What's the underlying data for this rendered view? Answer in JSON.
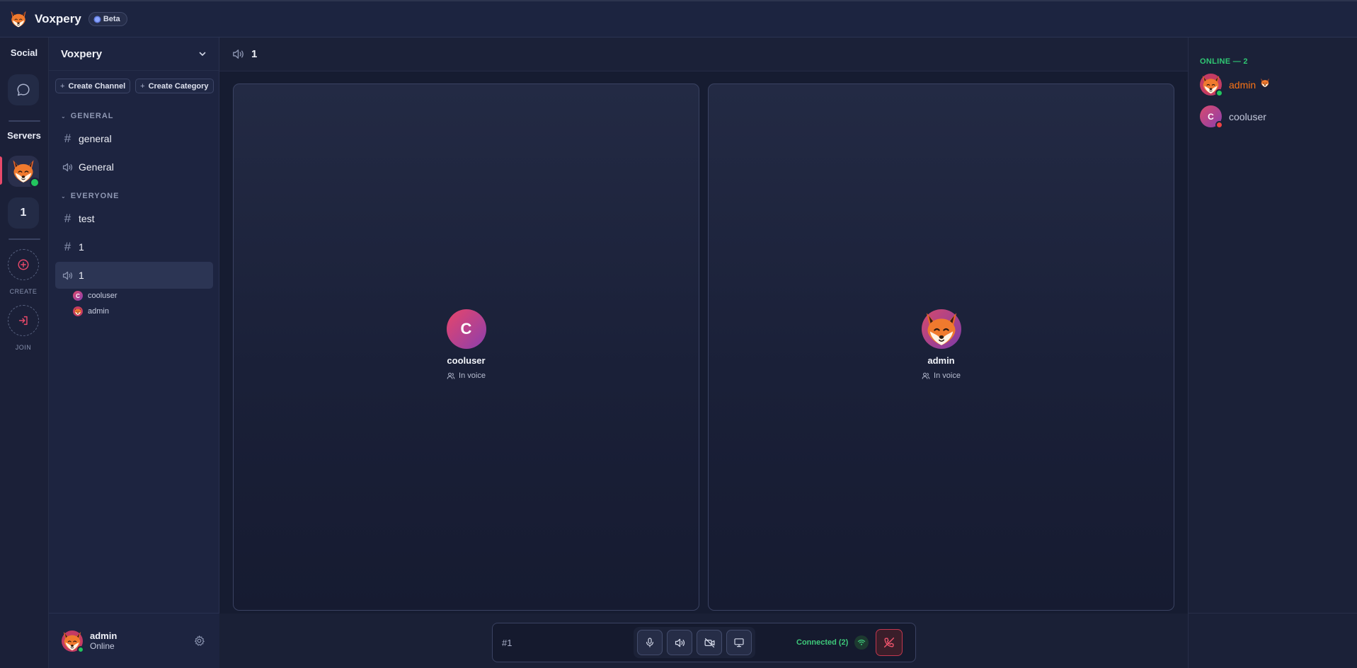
{
  "app": {
    "name": "Voxpery",
    "badge": "Beta"
  },
  "rail": {
    "social_label": "Social",
    "servers_label": "Servers",
    "server_2_label": "1",
    "create_label": "CREATE",
    "join_label": "JOIN"
  },
  "server": {
    "name": "Voxpery",
    "create_channel": "Create Channel",
    "create_category": "Create Category",
    "categories": [
      {
        "name": "GENERAL",
        "channels": [
          {
            "type": "text",
            "name": "general"
          },
          {
            "type": "voice",
            "name": "General"
          }
        ]
      },
      {
        "name": "EVERYONE",
        "channels": [
          {
            "type": "text",
            "name": "test"
          },
          {
            "type": "text",
            "name": "1"
          },
          {
            "type": "voice",
            "name": "1",
            "active": true
          }
        ]
      }
    ],
    "voice_users": [
      "cooluser",
      "admin"
    ]
  },
  "user": {
    "name": "admin",
    "status": "Online"
  },
  "main": {
    "channel_name": "1",
    "tiles": [
      {
        "name": "cooluser",
        "initial": "C",
        "status": "In voice"
      },
      {
        "name": "admin",
        "status": "In voice"
      }
    ]
  },
  "callbar": {
    "channel": "#1",
    "status": "Connected (2)"
  },
  "members": {
    "header": "ONLINE — 2",
    "list": [
      {
        "name": "admin",
        "emoji": "🦊",
        "status": "online",
        "color": "#f97316"
      },
      {
        "name": "cooluser",
        "initial": "C",
        "status": "dnd",
        "color": "#c4c9dc"
      }
    ]
  },
  "colors": {
    "accent": "#e8496a",
    "online": "#22c55e",
    "dnd": "#ef4444",
    "admin_name": "#f97316"
  }
}
